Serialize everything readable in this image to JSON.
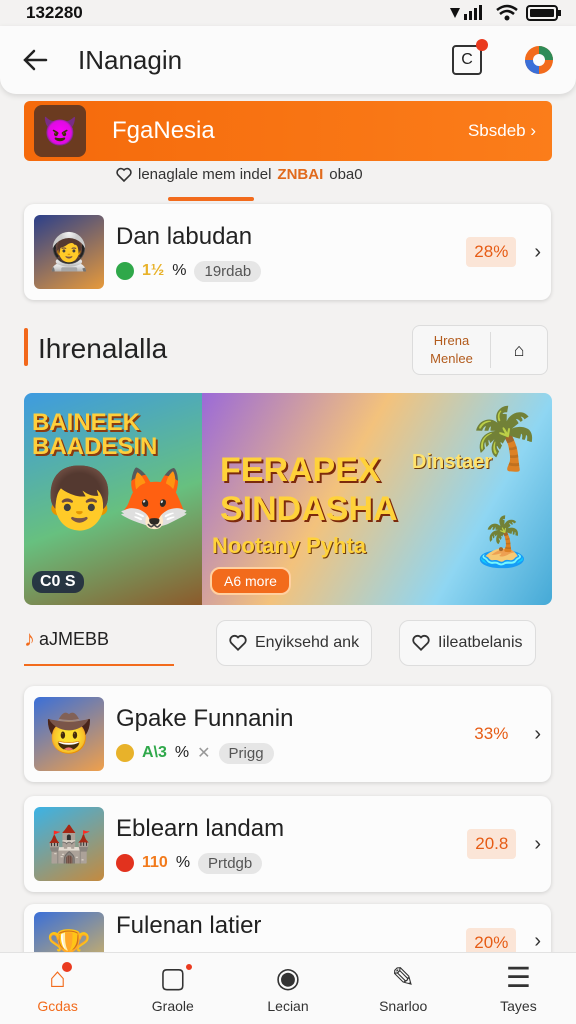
{
  "status": {
    "time": "132280",
    "signal_icon": "signal-icon",
    "wifi_icon": "wifi-icon",
    "battery_icon": "battery-icon"
  },
  "header": {
    "title": "INanagin",
    "notification_glyph": "C"
  },
  "promo": {
    "name": "FgaNesia",
    "link": "Sbsdeb ›"
  },
  "tip": {
    "text": "lenaglale mem indel",
    "highlight": "ZNBAI",
    "suffix": "oba0"
  },
  "top_card": {
    "title": "Dan labudan",
    "rating": "1½",
    "rating_suffix": "%",
    "tag": "19rdab",
    "percent": "28%",
    "accent": "#2fa84a"
  },
  "section": {
    "title": "Ihrenalalla",
    "more_label": "Hrena Menlee"
  },
  "banner": {
    "left_title": "BAINEEK BAADESIN",
    "left_badge": "C0 S",
    "right_title": "FERAPEX SINDASHA",
    "right_tag": "Dinstaer",
    "right_sub": "Nootany Pyhta",
    "right_cta": "A6 more"
  },
  "filters": {
    "main": "aJMEBB",
    "chip1": "Enyiksehd ank",
    "chip2": "Iileatbelanis"
  },
  "apps": [
    {
      "title": "Gpake Funnanin",
      "rating": "A\\3",
      "rating_suffix": "%",
      "tag": "Prigg",
      "percent": "33%",
      "dot": "#e8b22a",
      "rating_color": "#2fa84a"
    },
    {
      "title": "Eblearn landam",
      "rating": "110",
      "rating_suffix": "%",
      "tag": "Prtdgb",
      "percent": "20.8",
      "dot": "#e2321e",
      "rating_color": "#f27a1b"
    },
    {
      "title": "Fulenan latier",
      "percent": "20%"
    }
  ],
  "nav": [
    {
      "label": "Gcdas",
      "active": true
    },
    {
      "label": "Graole",
      "active": false
    },
    {
      "label": "Lecian",
      "active": false
    },
    {
      "label": "Snarloo",
      "active": false
    },
    {
      "label": "Tayes",
      "active": false
    }
  ],
  "colors": {
    "accent": "#f26b1c",
    "badge": "#ea3a1f"
  }
}
